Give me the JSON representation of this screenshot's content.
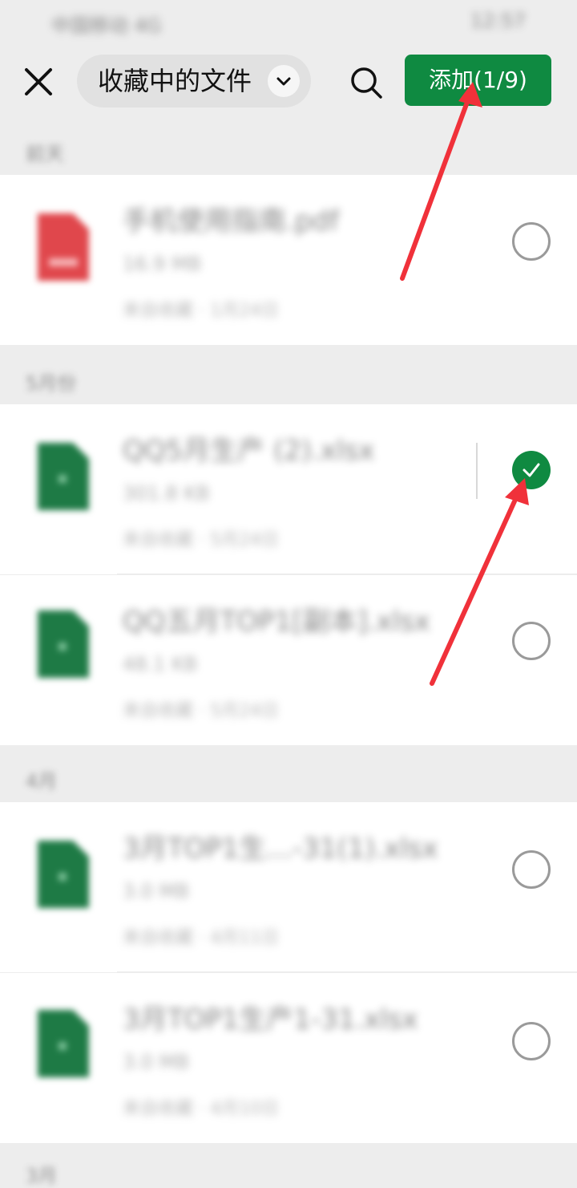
{
  "status_bar": {
    "left": "中国移动 4G",
    "right": "12:57"
  },
  "header": {
    "folder_label": "收藏中的文件",
    "add_button_label": "添加(1/9)"
  },
  "sections": [
    {
      "header": "前天",
      "files": [
        {
          "name": "手机使用指南.pdf",
          "size": "16.9 MB",
          "meta": "来自收藏 · 1月24日",
          "type": "pdf",
          "selected": false
        }
      ]
    },
    {
      "header": "5月份",
      "files": [
        {
          "name": "QQ5月生产 (2).xlsx",
          "size": "301.8 KB",
          "meta": "来自收藏 · 5月24日",
          "type": "xlsx",
          "selected": true
        },
        {
          "name": "QQ五月TOP1[副本].xlsx",
          "size": "48.1 KB",
          "meta": "来自收藏 · 5月24日",
          "type": "xlsx",
          "selected": false
        }
      ]
    },
    {
      "header": "4月",
      "files": [
        {
          "name": "3月TOP1生...-31(1).xlsx",
          "size": "3.0 MB",
          "meta": "来自收藏 · 4月11日",
          "type": "xlsx",
          "selected": false
        },
        {
          "name": "3月TOP1生产1-31.xlsx",
          "size": "3.0 MB",
          "meta": "来自收藏 · 4月10日",
          "type": "xlsx",
          "selected": false
        }
      ]
    },
    {
      "header": "3月"
    }
  ],
  "colors": {
    "accent": "#0f8a41",
    "pdf_red": "#e0474c",
    "xlsx_green": "#1e7a45",
    "annotation_arrow": "#f0313a",
    "background": "#ededed"
  },
  "icons": {
    "close": "close-icon",
    "dropdown": "chevron-down-icon",
    "search": "search-icon",
    "checkmark": "checkmark-icon"
  }
}
